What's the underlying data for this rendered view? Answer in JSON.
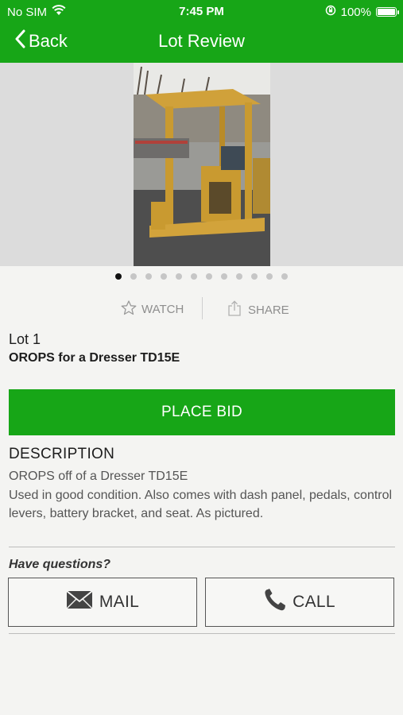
{
  "status_bar": {
    "carrier": "No SIM",
    "time": "7:45 PM",
    "battery": "100%",
    "icons": [
      "wifi-icon",
      "orientation-lock-icon",
      "battery-icon"
    ]
  },
  "nav": {
    "back_label": "Back",
    "title": "Lot Review"
  },
  "carousel": {
    "image_count": 12,
    "active_index": 0
  },
  "actions": {
    "watch_label": "WATCH",
    "share_label": "SHARE"
  },
  "lot": {
    "number": "Lot 1",
    "title": "OROPS for a Dresser TD15E"
  },
  "place_bid_label": "PLACE BID",
  "description": {
    "heading": "DESCRIPTION",
    "line1": "OROPS off of a Dresser TD15E",
    "line2": "Used in good condition. Also comes with dash panel, pedals, control levers, battery bracket, and seat. As pictured."
  },
  "contact": {
    "prompt": "Have questions?",
    "mail_label": "MAIL",
    "call_label": "CALL"
  },
  "colors": {
    "brand_green": "#17a617",
    "background": "#f4f4f2"
  }
}
